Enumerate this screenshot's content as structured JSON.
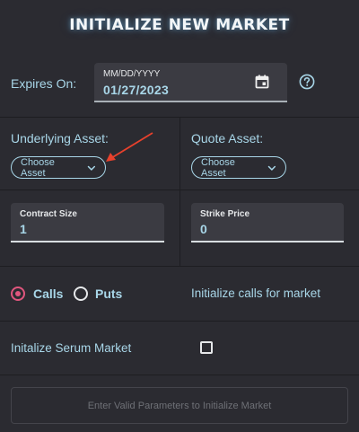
{
  "header": {
    "title": "INITIALIZE NEW MARKET"
  },
  "expires": {
    "label": "Expires On:",
    "placeholder": "MM/DD/YYYY",
    "value": "01/27/2023",
    "calendar_icon": "calendar-icon",
    "help_icon": "help-circle-icon"
  },
  "underlying": {
    "label": "Underlying Asset:",
    "button": "Choose Asset"
  },
  "quote": {
    "label": "Quote Asset:",
    "button": "Choose Asset"
  },
  "contract_size": {
    "label": "Contract Size",
    "value": "1"
  },
  "strike_price": {
    "label": "Strike Price",
    "value": "0"
  },
  "option_type": {
    "options": [
      {
        "label": "Calls",
        "selected": true
      },
      {
        "label": "Puts",
        "selected": false
      }
    ],
    "description": "Initialize calls for market"
  },
  "serum": {
    "label": "Initalize Serum Market",
    "checked": false
  },
  "submit": {
    "label": "Enter Valid Parameters to Initialize Market",
    "enabled": false
  },
  "colors": {
    "background": "#2b2b31",
    "accent": "#a8d6e8",
    "radio_selected": "#e0567e",
    "annotation_arrow": "#e8412c"
  }
}
